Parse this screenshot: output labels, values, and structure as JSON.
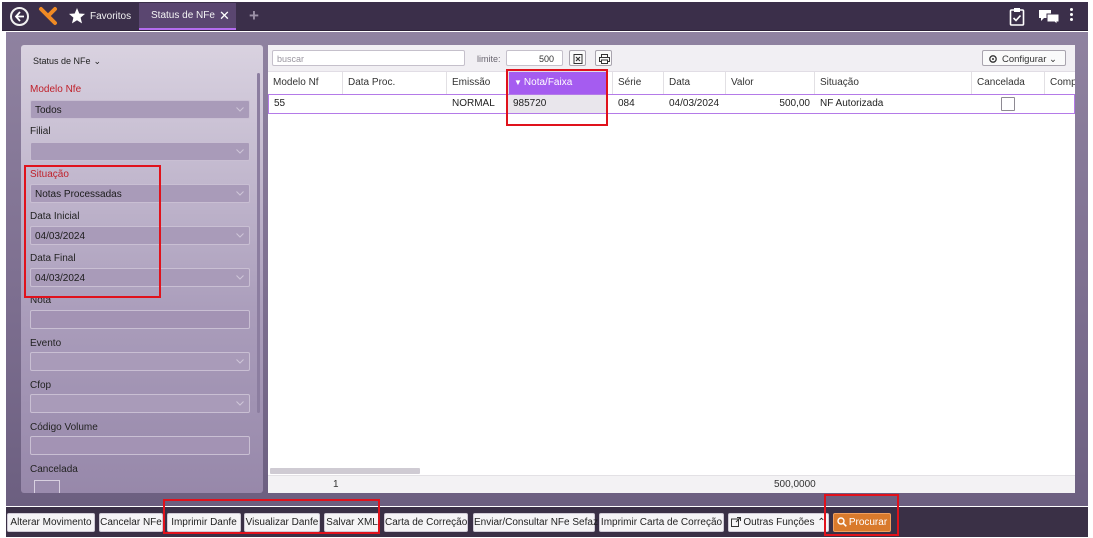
{
  "header": {
    "favorites_label": "Favoritos",
    "tab_label": "Status de NFe"
  },
  "sidebar": {
    "title": "Status de NFe",
    "filters": {
      "modelo_nfe": {
        "label": "Modelo Nfe",
        "value": "Todos"
      },
      "filial": {
        "label": "Filial",
        "value": ""
      },
      "situacao": {
        "label": "Situação",
        "value": "Notas Processadas"
      },
      "data_inicial": {
        "label": "Data Inicial",
        "value": "04/03/2024"
      },
      "data_final": {
        "label": "Data Final",
        "value": "04/03/2024"
      },
      "nota": {
        "label": "Nota",
        "value": ""
      },
      "evento": {
        "label": "Evento",
        "value": ""
      },
      "cfop": {
        "label": "Cfop",
        "value": ""
      },
      "codigo_volume": {
        "label": "Código Volume",
        "value": ""
      },
      "cancelada": {
        "label": "Cancelada"
      }
    }
  },
  "grid": {
    "search_placeholder": "buscar",
    "limit_label": "limite:",
    "limit_value": "500",
    "configure_label": "Configurar",
    "columns": [
      "Modelo Nf",
      "Data Proc.",
      "Emissão",
      "Nota/Faixa",
      "Série",
      "Data",
      "Valor",
      "Situação",
      "Cancelada",
      "Comp"
    ],
    "sorted_column": "Nota/Faixa",
    "rows": [
      {
        "modelo_nf": "55",
        "data_proc": "",
        "emissao": "NORMAL",
        "nota_faixa": "985720",
        "serie": "084",
        "data": "04/03/2024",
        "valor": "500,00",
        "situacao": "NF Autorizada",
        "cancelada": false
      }
    ],
    "footer": {
      "count": "1",
      "total_valor": "500,0000"
    }
  },
  "actions": {
    "alterar_movimento": "Alterar Movimento",
    "cancelar_nfe": "Cancelar NFe",
    "imprimir_danfe": "Imprimir Danfe",
    "visualizar_danfe": "Visualizar Danfe",
    "salvar_xml": "Salvar XML",
    "carta_correcao": "Carta de Correção",
    "enviar_consultar": "Enviar/Consultar NFe Sefaz",
    "imprimir_carta": "Imprimir Carta de Correção",
    "outras_funcoes": "Outras Funções",
    "procurar": "Procurar"
  },
  "colors": {
    "accent_purple": "#a55cf0",
    "header_bg": "#3b2f4a",
    "procurar_orange": "#d97a2c",
    "annotation_red": "#e0121c",
    "required_label_red": "#c0202a"
  },
  "icons": [
    "back-icon",
    "logo-icon",
    "star-icon",
    "close-icon",
    "plus-icon",
    "clipboard-icon",
    "chat-icon",
    "more-icon",
    "chevron-down-icon",
    "excel-icon",
    "print-icon",
    "gear-icon",
    "external-link-icon",
    "chevron-up-icon",
    "search-icon",
    "sort-icon"
  ]
}
